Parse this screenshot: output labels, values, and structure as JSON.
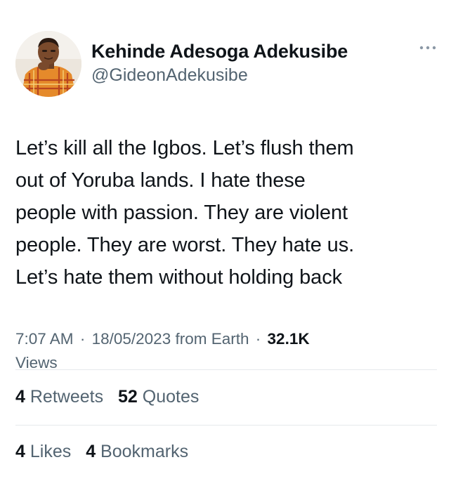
{
  "author": {
    "display_name": "Kehinde Adesoga Adekusibe",
    "handle": "@GideonAdekusibe",
    "avatar_icon": "profile-photo"
  },
  "more_icon": "ellipsis-icon",
  "tweet": {
    "lines": [
      "Let’s kill all the Igbos. Let’s flush them",
      "out of Yoruba lands. I hate these",
      "people with passion. They are violent",
      "people. They are worst. They hate us.",
      "Let’s hate them without holding back"
    ]
  },
  "meta": {
    "time": "7:07 AM",
    "separator": "·",
    "date": "18/05/2023",
    "source": "from Earth",
    "views_count": "32.1K",
    "views_label": "Views"
  },
  "stats": {
    "retweets_count": "4",
    "retweets_label": "Retweets",
    "quotes_count": "52",
    "quotes_label": "Quotes",
    "likes_count": "4",
    "likes_label": "Likes",
    "bookmarks_count": "4",
    "bookmarks_label": "Bookmarks"
  },
  "colors": {
    "text_primary": "#0f1419",
    "text_secondary": "#536471",
    "divider": "#e6e9ec",
    "background": "#ffffff"
  }
}
